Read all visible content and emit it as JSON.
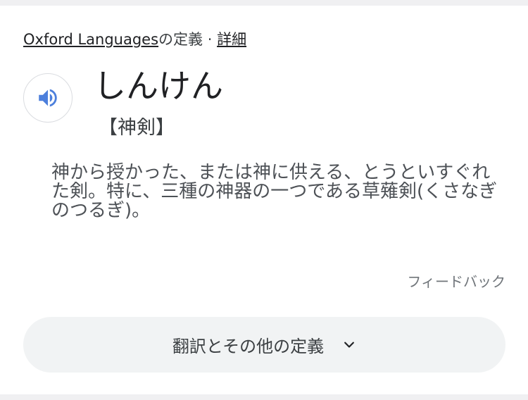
{
  "source": {
    "provider_link": "Oxford Languages",
    "provider_suffix": "の定義",
    "separator": " · ",
    "details_link": "詳細"
  },
  "entry": {
    "reading": "しんけん",
    "kanji": "【神剣】",
    "definition": "神から授かった、または神に供える、とうといすぐれた剣。特に、三種の神器の一つである草薙剣(くさなぎのつるぎ)。",
    "speaker_icon": "volume-icon"
  },
  "feedback_label": "フィードバック",
  "more_button": {
    "label": "翻訳とその他の定義",
    "icon": "chevron-down-icon"
  },
  "colors": {
    "speaker_blue": "#4c7fdc",
    "button_bg": "#f1f3f4"
  }
}
